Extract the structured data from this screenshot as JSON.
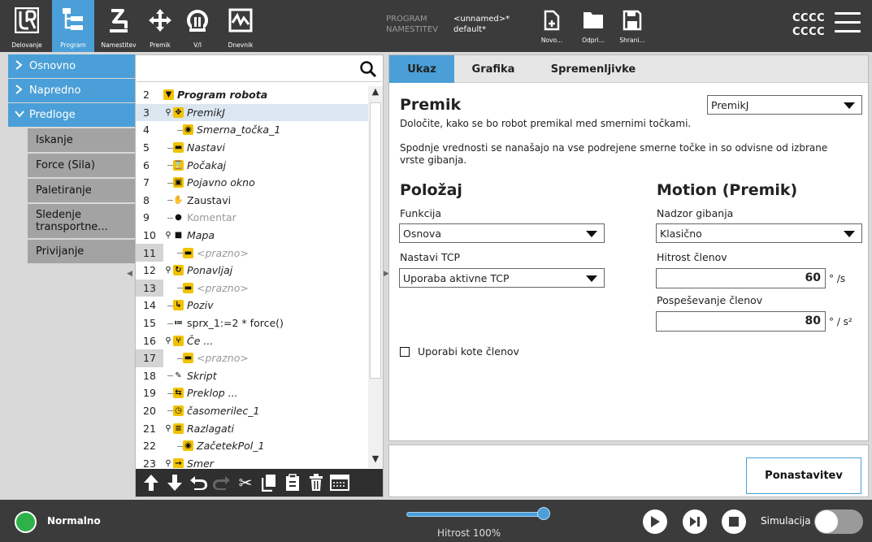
{
  "header": {
    "nav": [
      {
        "label": "Delovanje",
        "icon": "ur-logo-icon"
      },
      {
        "label": "Program",
        "icon": "program-tree-icon",
        "active": true
      },
      {
        "label": "Namestitev",
        "icon": "robot-arm-icon"
      },
      {
        "label": "Premik",
        "icon": "move-arrows-icon"
      },
      {
        "label": "V/I",
        "icon": "io-icon"
      },
      {
        "label": "Dnevnik",
        "icon": "log-chart-icon"
      }
    ],
    "program_key": "PROGRAM",
    "program_value": "<unnamed>*",
    "installation_key": "NAMESTITEV",
    "installation_value": "default*",
    "file_buttons": [
      {
        "label": "Novo...",
        "icon": "new-file-icon"
      },
      {
        "label": "Odpri...",
        "icon": "folder-icon"
      },
      {
        "label": "Shrani...",
        "icon": "save-icon"
      }
    ],
    "user_line1": "CCCC",
    "user_line2": "CCCC"
  },
  "leftnav": {
    "categories": [
      {
        "label": "Osnovno",
        "expanded": false
      },
      {
        "label": "Napredno",
        "expanded": false
      },
      {
        "label": "Predloge",
        "expanded": true
      }
    ],
    "templates": [
      "Iskanje",
      "Force (Sila)",
      "Paletiranje",
      "Sledenje transportne...",
      "Privijanje"
    ]
  },
  "tree": {
    "search_placeholder": "",
    "rows": [
      {
        "num": "2",
        "label": "Program robota"
      },
      {
        "num": "3",
        "label": "PremikJ"
      },
      {
        "num": "4",
        "label": "Smerna_točka_1"
      },
      {
        "num": "5",
        "label": "Nastavi"
      },
      {
        "num": "6",
        "label": "Počakaj"
      },
      {
        "num": "7",
        "label": "Pojavno okno"
      },
      {
        "num": "8",
        "label": "Zaustavi"
      },
      {
        "num": "9",
        "label": "Komentar"
      },
      {
        "num": "10",
        "label": "Mapa"
      },
      {
        "num": "11",
        "label": "<prazno>"
      },
      {
        "num": "12",
        "label": "Ponavljaj"
      },
      {
        "num": "13",
        "label": "<prazno>"
      },
      {
        "num": "14",
        "label": "Poziv"
      },
      {
        "num": "15",
        "label": "sprx_1:=2 * force()"
      },
      {
        "num": "16",
        "label": "Če ..."
      },
      {
        "num": "17",
        "label": "<prazno>"
      },
      {
        "num": "18",
        "label": "Skript"
      },
      {
        "num": "19",
        "label": "Preklop ..."
      },
      {
        "num": "20",
        "label": "časomerilec_1"
      },
      {
        "num": "21",
        "label": "Razlagati"
      },
      {
        "num": "22",
        "label": "ZačetekPol_1"
      },
      {
        "num": "23",
        "label": "Smer"
      }
    ]
  },
  "tabs": [
    "Ukaz",
    "Grafika",
    "Spremenljivke"
  ],
  "command": {
    "title": "Premik",
    "type_value": "PremikJ",
    "description": "Določite, kako se bo robot premikal med smernimi točkami.",
    "note": "Spodnje vrednosti se nanašajo na vse podrejene smerne točke in so odvisne od izbrane vrste gibanja.",
    "position_heading": "Položaj",
    "function_label": "Funkcija",
    "function_value": "Osnova",
    "tcp_label": "Nastavi TCP",
    "tcp_value": "Uporaba aktivne TCP",
    "motion_heading": "Motion (Premik)",
    "motion_control_label": "Nadzor gibanja",
    "motion_control_value": "Klasično",
    "joint_speed_label": "Hitrost členov",
    "joint_speed_value": "60",
    "joint_speed_unit": "° /s",
    "joint_accel_label": "Pospeševanje členov",
    "joint_accel_value": "80",
    "joint_accel_unit": "° / s²",
    "joint_angles_label": "Uporabi kote členov",
    "reset_label": "Ponastavitev"
  },
  "footer": {
    "status": "Normalno",
    "status_color": "#2fb14a",
    "speed_text": "Hitrost 100%",
    "speed_fraction": 1.0,
    "sim_label": "Simulacija",
    "accent": "#4a9fd8"
  }
}
